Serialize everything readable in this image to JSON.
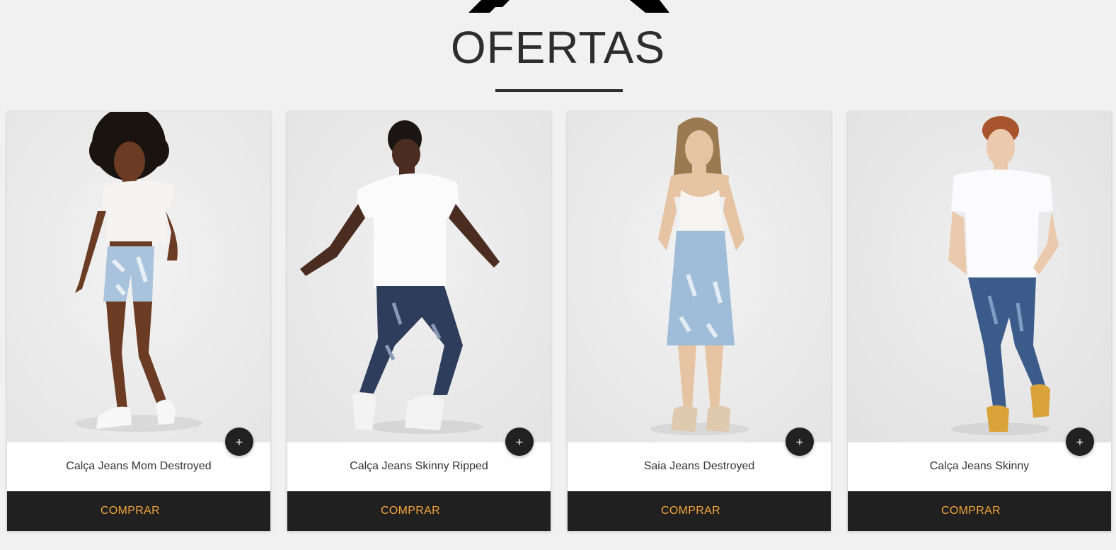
{
  "section": {
    "title": "OFERTAS"
  },
  "colors": {
    "background": "#f1f1f1",
    "card_bg": "#ffffff",
    "buy_button_bg": "#202020",
    "buy_button_text": "#f4a53b",
    "plus_button_bg": "#212121",
    "title_text": "#2d2d2d"
  },
  "products": [
    {
      "name": "Calça Jeans Mom Destroyed",
      "buy_label": "COMPRAR",
      "plus_label": "+",
      "image_icon": "model-photo-denim-shorts"
    },
    {
      "name": "Calça Jeans Skinny Ripped",
      "buy_label": "COMPRAR",
      "plus_label": "+",
      "image_icon": "model-photo-ripped-jeans"
    },
    {
      "name": "Saia Jeans Destroyed",
      "buy_label": "COMPRAR",
      "plus_label": "+",
      "image_icon": "model-photo-denim-skirt"
    },
    {
      "name": "Calça Jeans Skinny",
      "buy_label": "COMPRAR",
      "plus_label": "+",
      "image_icon": "model-photo-skinny-jeans"
    }
  ]
}
